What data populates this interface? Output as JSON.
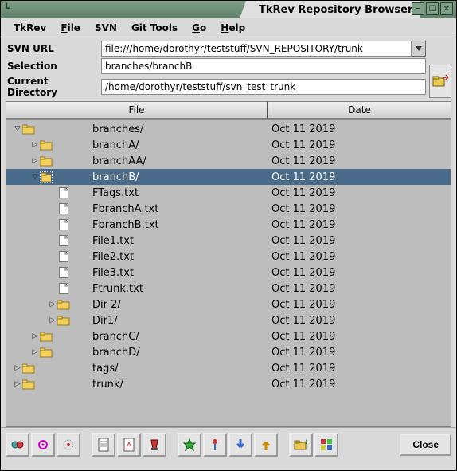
{
  "window": {
    "title": "TkRev Repository Browser"
  },
  "menu": {
    "tkrev": "TkRev",
    "file": "File",
    "svn": "SVN",
    "git_tools": "Git Tools",
    "go": "Go",
    "help": "Help"
  },
  "fields": {
    "url_label": "SVN URL",
    "url_value": "file:///home/dorothyr/teststuff/SVN_REPOSITORY/trunk",
    "selection_label": "Selection",
    "selection_value": "branches/branchB",
    "cwd_label": "Current Directory",
    "cwd_value": "/home/dorothyr/teststuff/svn_test_trunk"
  },
  "columns": {
    "file": "File",
    "date": "Date"
  },
  "tree": [
    {
      "depth": 0,
      "twisty": "open",
      "type": "folder",
      "name": "branches/",
      "date": "Oct 11 2019",
      "selected": false
    },
    {
      "depth": 1,
      "twisty": "closed",
      "type": "folder",
      "name": "branchA/",
      "date": "Oct 11 2019",
      "selected": false
    },
    {
      "depth": 1,
      "twisty": "closed",
      "type": "folder",
      "name": "branchAA/",
      "date": "Oct 11 2019",
      "selected": false
    },
    {
      "depth": 1,
      "twisty": "open",
      "type": "folder",
      "name": "branchB/",
      "date": "Oct 11 2019",
      "selected": true
    },
    {
      "depth": 2,
      "twisty": "",
      "type": "file",
      "name": "FTags.txt",
      "date": "Oct 11 2019",
      "selected": false
    },
    {
      "depth": 2,
      "twisty": "",
      "type": "file",
      "name": "FbranchA.txt",
      "date": "Oct 11 2019",
      "selected": false
    },
    {
      "depth": 2,
      "twisty": "",
      "type": "file",
      "name": "FbranchB.txt",
      "date": "Oct 11 2019",
      "selected": false
    },
    {
      "depth": 2,
      "twisty": "",
      "type": "file",
      "name": "File1.txt",
      "date": "Oct 11 2019",
      "selected": false
    },
    {
      "depth": 2,
      "twisty": "",
      "type": "file",
      "name": "File2.txt",
      "date": "Oct 11 2019",
      "selected": false
    },
    {
      "depth": 2,
      "twisty": "",
      "type": "file",
      "name": "File3.txt",
      "date": "Oct 11 2019",
      "selected": false
    },
    {
      "depth": 2,
      "twisty": "",
      "type": "file",
      "name": "Ftrunk.txt",
      "date": "Oct 11 2019",
      "selected": false
    },
    {
      "depth": 2,
      "twisty": "closed",
      "type": "folder",
      "name": "Dir 2/",
      "date": "Oct 11 2019",
      "selected": false
    },
    {
      "depth": 2,
      "twisty": "closed",
      "type": "folder",
      "name": "Dir1/",
      "date": "Oct 11 2019",
      "selected": false
    },
    {
      "depth": 1,
      "twisty": "closed",
      "type": "folder",
      "name": "branchC/",
      "date": "Oct 11 2019",
      "selected": false
    },
    {
      "depth": 1,
      "twisty": "closed",
      "type": "folder",
      "name": "branchD/",
      "date": "Oct 11 2019",
      "selected": false
    },
    {
      "depth": 0,
      "twisty": "closed",
      "type": "folder",
      "name": "tags/",
      "date": "Oct 11 2019",
      "selected": false
    },
    {
      "depth": 0,
      "twisty": "closed",
      "type": "folder",
      "name": "trunk/",
      "date": "Oct 11 2019",
      "selected": false
    }
  ],
  "toolbar": {
    "close": "Close"
  }
}
